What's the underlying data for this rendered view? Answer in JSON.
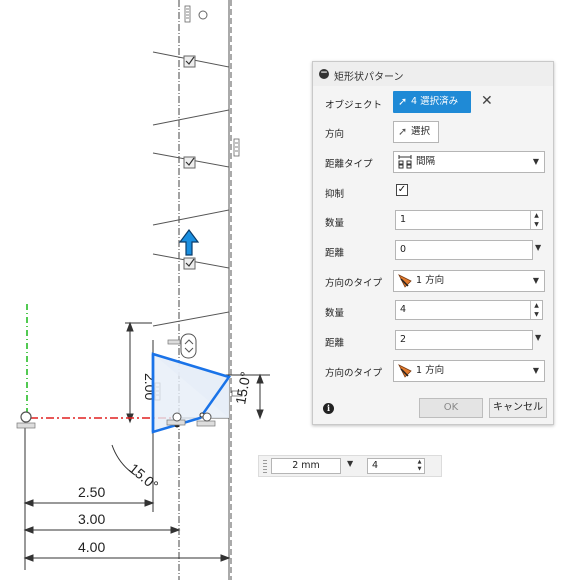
{
  "dialog": {
    "title": "矩形状パターン",
    "rows": {
      "objects": {
        "label": "オブジェクト",
        "button": "4 選択済み"
      },
      "direction": {
        "label": "方向",
        "button": "選択"
      },
      "distance_type": {
        "label": "距離タイプ",
        "value": "間隔"
      },
      "suppress": {
        "label": "抑制",
        "checked": true
      },
      "qty1": {
        "label": "数量",
        "value": "1"
      },
      "dist1": {
        "label": "距離",
        "value": "0"
      },
      "dirtype1": {
        "label": "方向のタイプ",
        "value": "1 方向"
      },
      "qty2": {
        "label": "数量",
        "value": "4"
      },
      "dist2": {
        "label": "距離",
        "value": "2"
      },
      "dirtype2": {
        "label": "方向のタイプ",
        "value": "1 方向"
      }
    },
    "ok": "OK",
    "cancel": "キャンセル"
  },
  "bottom_bar": {
    "spacing": "2 mm",
    "count": "4"
  },
  "sketch": {
    "dims": {
      "d250": "2.50",
      "d300": "3.00",
      "d400": "4.00",
      "d200": "2.00",
      "a15a": "15.0°",
      "a15b": "15.0°"
    }
  },
  "colors": {
    "accent": "#1f8ad6",
    "selection": "#1a73e8",
    "axis_x": "#e02020",
    "axis_y": "#18b818",
    "arrow": "#1a8fe0"
  },
  "icons": [
    "collapse-icon",
    "cursor-icon",
    "close-icon",
    "spacing-icon",
    "direction-icon",
    "info-icon",
    "checkbox-icon",
    "move-arrow-icon",
    "origin-icon",
    "constraint-icon"
  ]
}
